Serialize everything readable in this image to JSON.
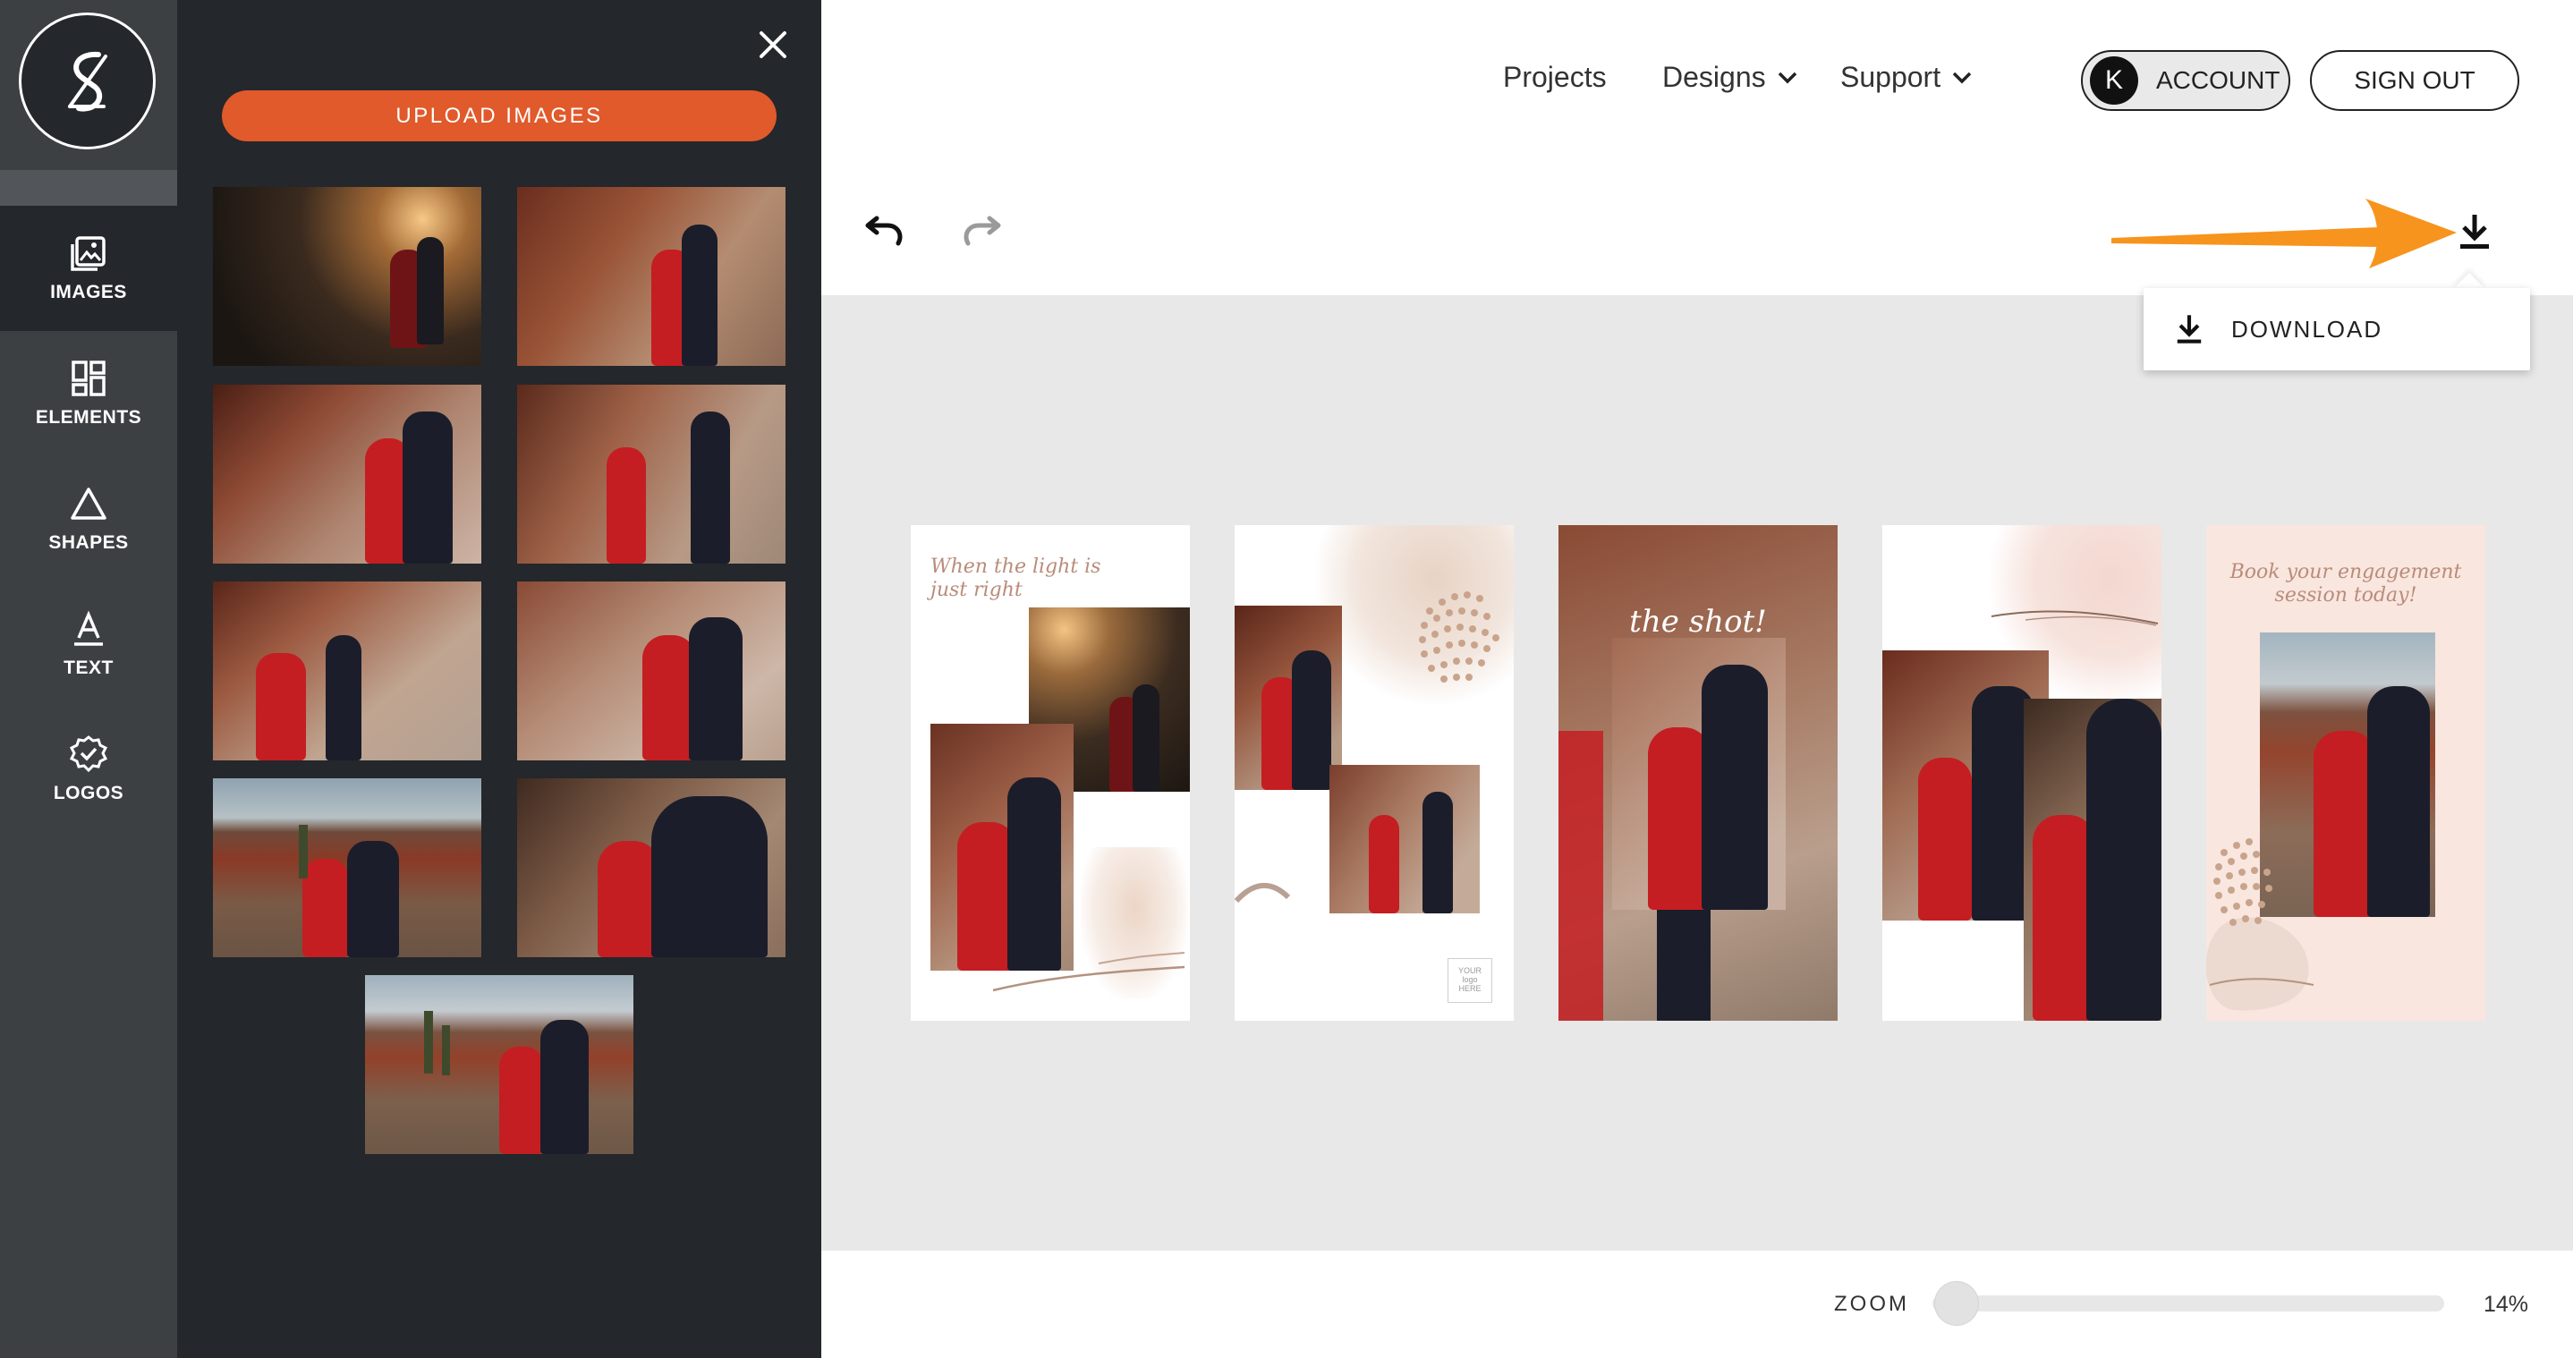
{
  "sidebar": {
    "items": [
      {
        "id": "images",
        "label": "IMAGES",
        "icon": "image-icon",
        "active": true
      },
      {
        "id": "elements",
        "label": "ELEMENTS",
        "icon": "grid-icon"
      },
      {
        "id": "shapes",
        "label": "SHAPES",
        "icon": "triangle-icon"
      },
      {
        "id": "text",
        "label": "TEXT",
        "icon": "text-icon"
      },
      {
        "id": "logos",
        "label": "LOGOS",
        "icon": "badge-icon"
      }
    ]
  },
  "panel": {
    "upload_label": "UPLOAD IMAGES",
    "close_icon": "close-icon"
  },
  "nav": {
    "projects": "Projects",
    "designs": "Designs",
    "support": "Support",
    "account_initial": "K",
    "account": "ACCOUNT",
    "signout": "SIGN OUT"
  },
  "toolbar": {
    "undo_icon": "undo-icon",
    "redo_icon": "redo-icon",
    "download_icon": "download-icon"
  },
  "download_menu": {
    "item_label": "DOWNLOAD"
  },
  "designs": {
    "d1_text": "When the light is just right",
    "d2_logo": "YOUR logo HERE",
    "d3_text": "the shot!",
    "d5_text": "Book your engagement session today!"
  },
  "zoom": {
    "label": "ZOOM",
    "value": "14%",
    "level": 0.14
  },
  "colors": {
    "accent": "#e05a2b",
    "annotation_arrow": "#f7941d",
    "dark_panel": "#24272b",
    "rail": "#3c4043",
    "canvas": "#e8e8e8"
  }
}
